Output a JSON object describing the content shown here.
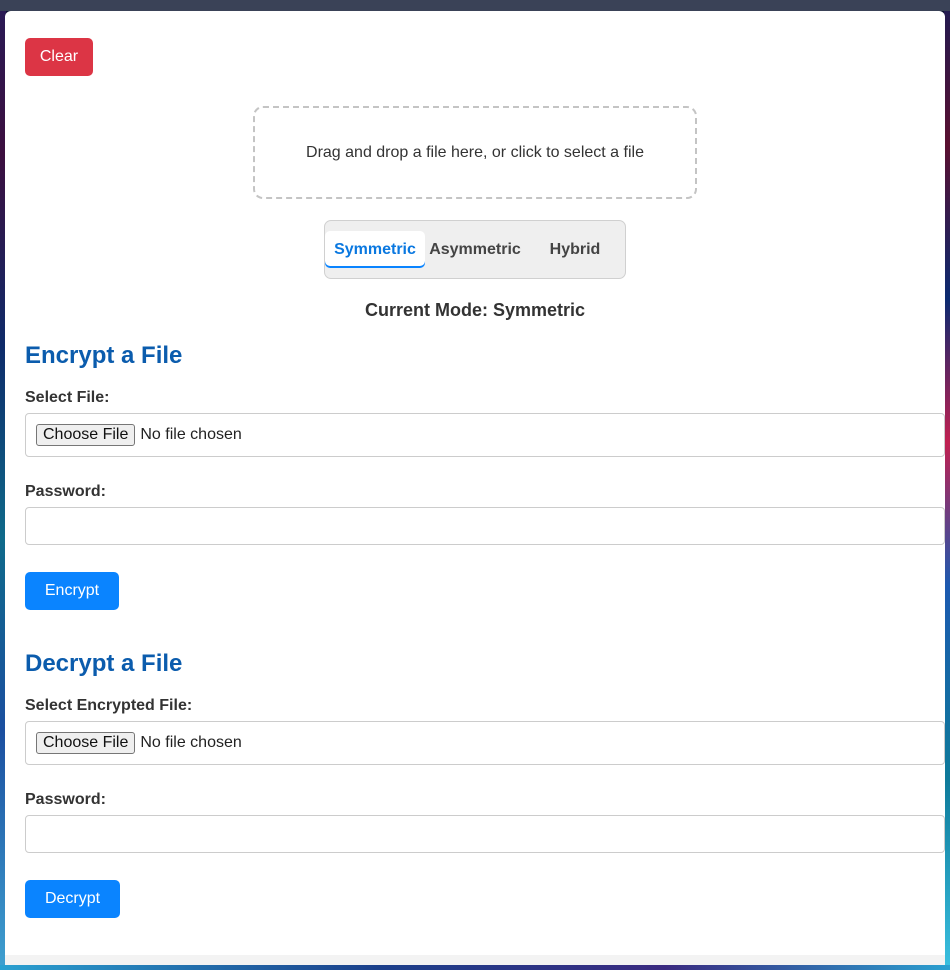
{
  "toolbar": {
    "clear_label": "Clear",
    "clear_color": "#dc3545"
  },
  "dropzone": {
    "text": "Drag and drop a file here, or click to select a file"
  },
  "modes": {
    "tabs": [
      {
        "label": "Symmetric",
        "active": true
      },
      {
        "label": "Asymmetric",
        "active": false
      },
      {
        "label": "Hybrid",
        "active": false
      }
    ],
    "current_mode_text": "Current Mode: Symmetric"
  },
  "encrypt": {
    "title": "Encrypt a File",
    "file_label": "Select File:",
    "file_button": "Choose File",
    "file_status": "No file chosen",
    "password_label": "Password:",
    "password_value": "",
    "submit_label": "Encrypt"
  },
  "decrypt": {
    "title": "Decrypt a File",
    "file_label": "Select Encrypted File:",
    "file_button": "Choose File",
    "file_status": "No file chosen",
    "password_label": "Password:",
    "password_value": "",
    "submit_label": "Decrypt"
  },
  "colors": {
    "primary": "#0a84ff",
    "danger": "#dc3545",
    "heading": "#0b5cad"
  }
}
